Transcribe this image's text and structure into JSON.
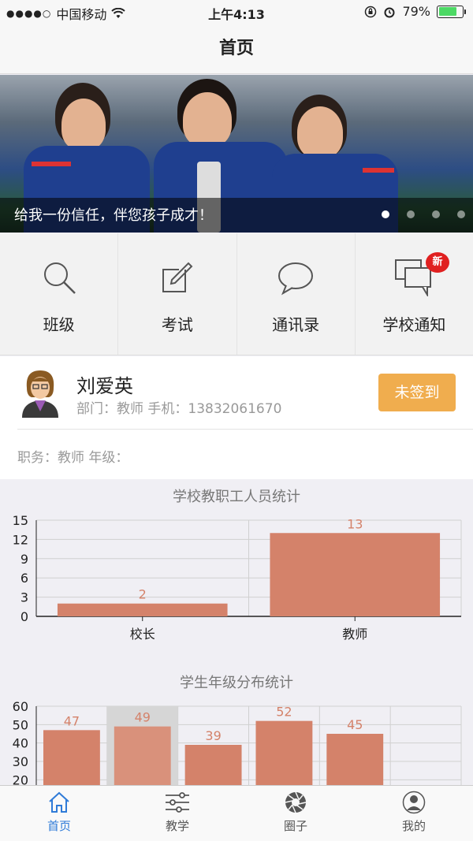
{
  "status_bar": {
    "carrier": "中国移动",
    "time": "上午4:13",
    "battery": "79%",
    "battery_level": 0.79
  },
  "nav": {
    "title": "首页"
  },
  "banner": {
    "caption": "给我一份信任，伴您孩子成才！",
    "page_count": 4,
    "active_page": 0
  },
  "menu": {
    "items": [
      {
        "label": "班级",
        "icon": "search-icon"
      },
      {
        "label": "考试",
        "icon": "edit-icon"
      },
      {
        "label": "通讯录",
        "icon": "chat-bubble-icon"
      },
      {
        "label": "学校通知",
        "icon": "notification-chat-icon",
        "badge": "新"
      }
    ]
  },
  "profile": {
    "name": "刘爱英",
    "meta": "部门：教师 手机：13832061670",
    "sign_label": "未签到",
    "duty": "职务：教师 年级："
  },
  "chart_data": [
    {
      "type": "bar",
      "title": "学校教职工人员统计",
      "categories": [
        "校长",
        "教师"
      ],
      "values": [
        2,
        13
      ],
      "ylim": [
        0,
        15
      ],
      "yticks": [
        0,
        3,
        6,
        9,
        12,
        15
      ],
      "grid": true,
      "color": "#d4826a"
    },
    {
      "type": "bar",
      "title": "学生年级分布统计",
      "categories": [
        "",
        "",
        "",
        "",
        "",
        ""
      ],
      "values": [
        47,
        49,
        39,
        52,
        45
      ],
      "ylim": [
        0,
        60
      ],
      "yticks": [
        20,
        30,
        40,
        50,
        60
      ],
      "grid": true,
      "highlighted_index": 1,
      "color": "#d4826a"
    }
  ],
  "tabs": [
    {
      "label": "首页",
      "icon": "home-icon",
      "active": true
    },
    {
      "label": "教学",
      "icon": "sliders-icon",
      "active": false
    },
    {
      "label": "圈子",
      "icon": "aperture-icon",
      "active": false
    },
    {
      "label": "我的",
      "icon": "user-icon",
      "active": false
    }
  ]
}
